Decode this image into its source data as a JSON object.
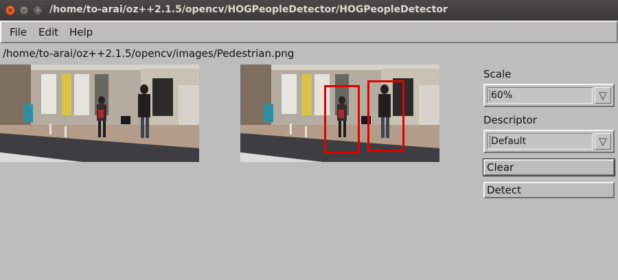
{
  "window": {
    "title": "/home/to-arai/oz++2.1.5/opencv/HOGPeopleDetector/HOGPeopleDetector",
    "controls": [
      "close-icon",
      "minimize-icon",
      "maximize-icon"
    ]
  },
  "menubar": {
    "items": [
      {
        "label": "File"
      },
      {
        "label": "Edit"
      },
      {
        "label": "Help"
      }
    ]
  },
  "image_path": "/home/to-arai/oz++2.1.5/opencv/images/Pedestrian.png",
  "controls": {
    "scale": {
      "label": "Scale",
      "value": "60%"
    },
    "descriptor": {
      "label": "Descriptor",
      "value": "Default"
    },
    "clear_label": "Clear",
    "detect_label": "Detect"
  },
  "colors": {
    "window_bg": "#bdbdbd",
    "titlebar_bg": "#3c3b37",
    "detection_box": "#e10000"
  }
}
